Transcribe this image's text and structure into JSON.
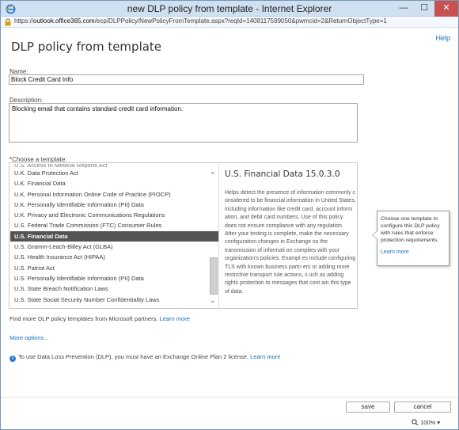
{
  "window": {
    "title": "new DLP policy from template - Internet Explorer",
    "url_prefix": "https://",
    "url_host": "outlook.office365.com",
    "url_path": "/ecp/DLPPolicy/NewPolicyFromTemplate.aspx?reqId=1408117599050&pwmcid=2&ReturnObjectType=1",
    "minimize_glyph": "—",
    "maximize_glyph": "☐",
    "close_glyph": "✕"
  },
  "header": {
    "help": "Help",
    "page_title": "DLP policy from template"
  },
  "form": {
    "name_label": "Name:",
    "name_value": "Block Credit Card Info",
    "description_label": "Description:",
    "description_value": "Blocking email that contains standard credit card information.",
    "choose_label": "*Choose a template:"
  },
  "templates": {
    "items": [
      "U.S. Access to Medical Reports Act",
      "U.K. Data Protection Act",
      "U.K. Financial Data",
      "U.K. Personal Information Online Code of Practice (PIOCP)",
      "U.K. Personally Identifiable Information (PII) Data",
      "U.K. Privacy and Electronic Communications Regulations",
      "U.S. Federal Trade Commission (FTC) Consumer Rules",
      "U.S. Financial Data",
      "U.S. Gramm-Leach-Bliley Act (GLBA)",
      "U.S. Health Insurance Act (HIPAA)",
      "U.S. Patriot Act",
      "U.S. Personally Identifiable Information (PII) Data",
      "U.S. State Breach Notification Laws",
      "U.S. State Social Security Number Confidentiality Laws"
    ],
    "selected": "U.S. Financial Data",
    "scroll_up_glyph": "⌃",
    "scroll_down_glyph": "⌄"
  },
  "detail": {
    "title": "U.S. Financial Data  15.0.3.0",
    "description": "Helps detect the presence of information commonly c onsidered to be financial information in United States, including information like credit card, account inform ation, and debit card numbers. Use of this policy does not ensure compliance with any regulation. After your testing is complete, make the necessary configuration changes in Exchange so the transmission of informati on complies with your organization's policies. Exampl es include configuring TLS with known business partn ers or adding more restrictive transport rule actions, s uch as adding rights protection to messages that cont ain this type of data."
  },
  "tooltip": {
    "text": "Choose one template to configure this DLP policy with rules that enforce protection requirements.",
    "learn_more": "Learn more"
  },
  "footer": {
    "find_more_text": "Find more DLP policy templates from Microsoft partners.",
    "find_more_link": "Learn more",
    "more_options": "More options...",
    "info_text": "To use Data Loss Prevention (DLP), you must have an Exchange Online Plan 2 license.",
    "info_link": "Learn more",
    "save": "save",
    "cancel": "cancel",
    "zoom": "100%"
  }
}
